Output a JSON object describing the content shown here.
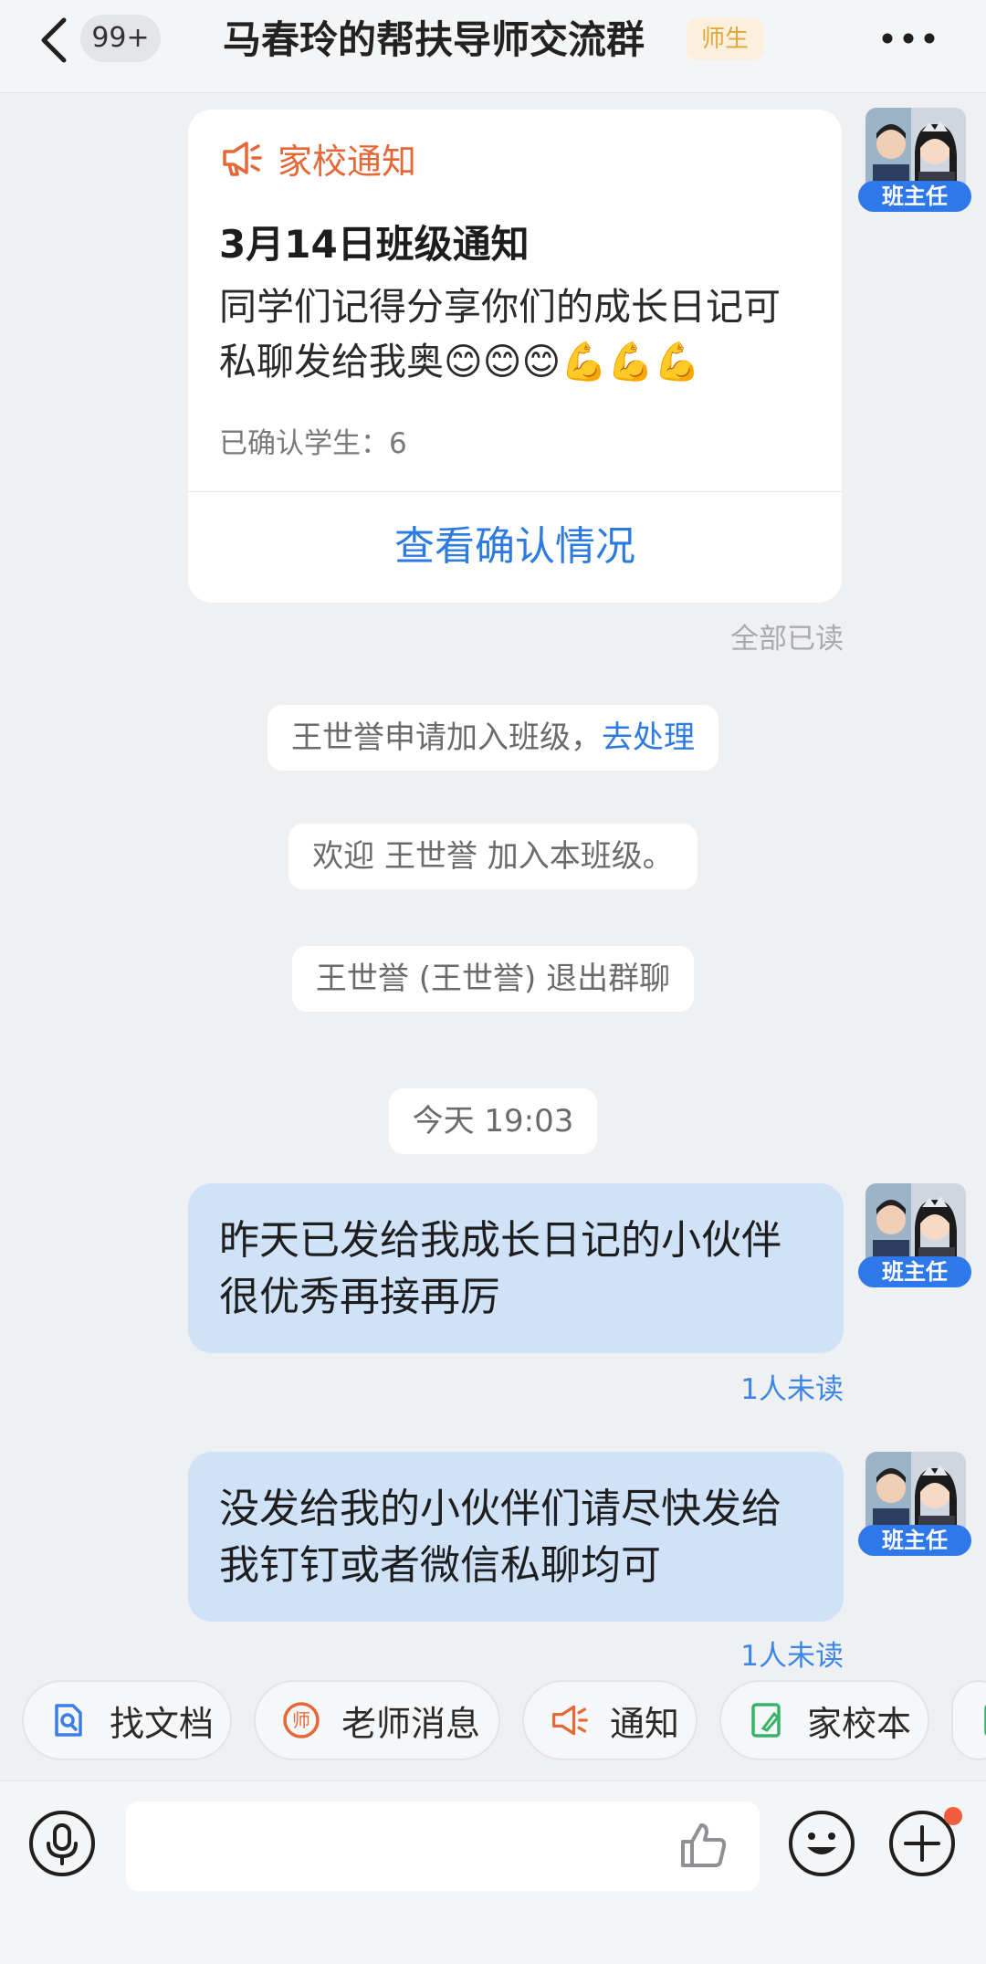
{
  "header": {
    "back_label": "back",
    "unread_count": "99+",
    "title": "马春玲的帮扶导师交流群",
    "role_tag": "师生"
  },
  "avatar_badge": "班主任",
  "notice": {
    "type_label": "家校通知",
    "title": "3月14日班级通知",
    "body": "同学们记得分享你们的成长日记可私聊发给我奥😊😊😊💪💪💪",
    "confirmed": "已确认学生：6",
    "link_label": "查看确认情况",
    "read_status": "全部已读"
  },
  "system_tips": {
    "apply_text": "王世誉申请加入班级，",
    "apply_link": "去处理",
    "welcome": "欢迎 王世誉 加入本班级。",
    "left": "王世誉 (王世誉) 退出群聊",
    "timestamp": "今天 19:03"
  },
  "messages": [
    {
      "text": "昨天已发给我成长日记的小伙伴很优秀再接再厉",
      "status": "1人未读"
    },
    {
      "text": "没发给我的小伙伴们请尽快发给我钉钉或者微信私聊均可",
      "status": "1人未读"
    }
  ],
  "quick_actions": [
    {
      "label": "找文档",
      "icon": "doc-search-icon"
    },
    {
      "label": "老师消息",
      "icon": "teacher-icon"
    },
    {
      "label": "通知",
      "icon": "megaphone-icon"
    },
    {
      "label": "家校本",
      "icon": "homework-book-icon"
    }
  ],
  "input": {
    "placeholder": ""
  },
  "colors": {
    "accent_blue": "#2e7be0",
    "notice_orange": "#e56838",
    "bubble_blue": "#cfe2f8",
    "badge_blue": "#2f78ea",
    "tag_gold": "#e0a83a"
  }
}
